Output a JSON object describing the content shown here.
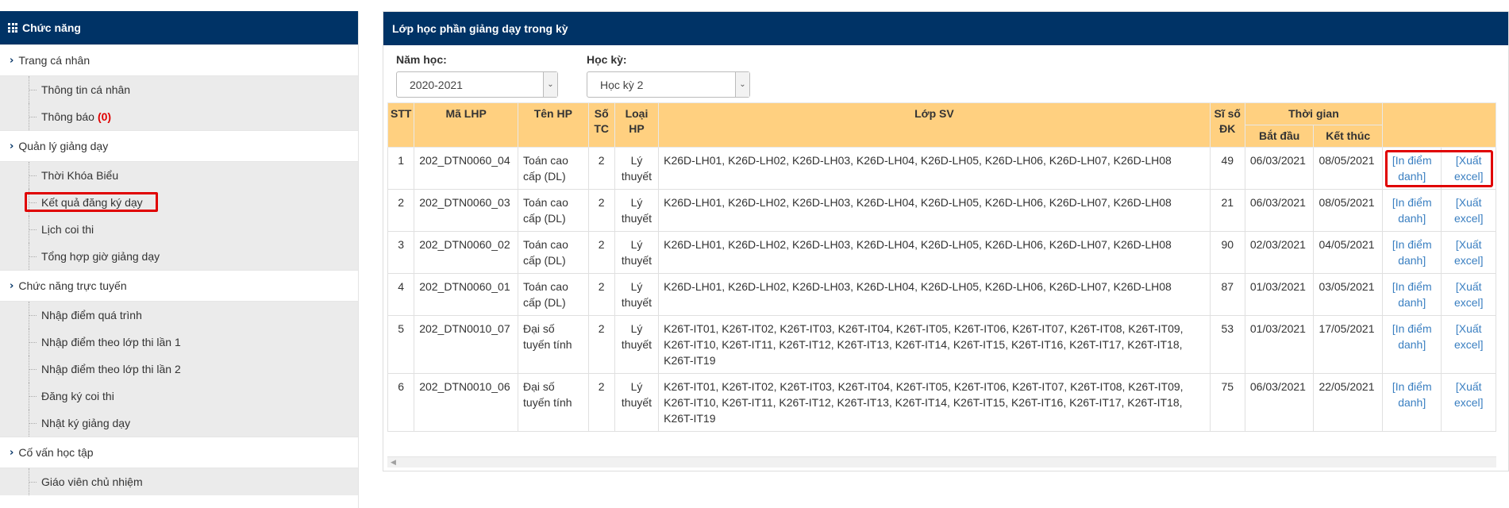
{
  "sidebar": {
    "title": "Chức năng",
    "groups": [
      {
        "label": "Trang cá nhân",
        "items": [
          {
            "label": "Thông tin cá nhân"
          },
          {
            "label": "Thông báo",
            "badge": "(0)"
          }
        ]
      },
      {
        "label": "Quản lý giảng dạy",
        "items": [
          {
            "label": "Thời Khóa Biểu"
          },
          {
            "label": "Kết quả đăng ký dạy"
          },
          {
            "label": "Lịch coi thi"
          },
          {
            "label": "Tổng hợp giờ giảng dạy"
          }
        ]
      },
      {
        "label": "Chức năng trực tuyến",
        "items": [
          {
            "label": "Nhập điểm quá trình"
          },
          {
            "label": "Nhập điểm theo lớp thi lần 1"
          },
          {
            "label": "Nhập điểm theo lớp thi lần 2"
          },
          {
            "label": "Đăng ký coi thi"
          },
          {
            "label": "Nhật ký giảng dạy"
          }
        ]
      },
      {
        "label": "Cố vấn học tập",
        "items": [
          {
            "label": "Giáo viên chủ nhiệm"
          }
        ]
      }
    ]
  },
  "main": {
    "title": "Lớp học phần giảng dạy trong kỳ",
    "filters": {
      "year_label": "Năm học:",
      "year_value": "2020-2021",
      "semester_label": "Học kỳ:",
      "semester_value": "Học kỳ 2"
    },
    "table": {
      "headers": {
        "stt": "STT",
        "ma_lhp": "Mã LHP",
        "ten_hp": "Tên HP",
        "so_tc": "Số TC",
        "loai_hp": "Loại HP",
        "lop_sv": "Lớp SV",
        "si_so": "Sĩ số ĐK",
        "thoi_gian": "Thời gian",
        "bat_dau": "Bắt đầu",
        "ket_thuc": "Kết thúc"
      },
      "action_print": "[In điểm danh]",
      "action_export": "[Xuất excel]",
      "rows": [
        {
          "stt": "1",
          "ma_lhp": "202_DTN0060_04",
          "ten_hp": "Toán cao cấp (DL)",
          "so_tc": "2",
          "loai_hp": "Lý thuyết",
          "lop_sv": "K26D-LH01, K26D-LH02, K26D-LH03, K26D-LH04, K26D-LH05, K26D-LH06, K26D-LH07, K26D-LH08",
          "si_so": "49",
          "bat_dau": "06/03/2021",
          "ket_thuc": "08/05/2021"
        },
        {
          "stt": "2",
          "ma_lhp": "202_DTN0060_03",
          "ten_hp": "Toán cao cấp (DL)",
          "so_tc": "2",
          "loai_hp": "Lý thuyết",
          "lop_sv": "K26D-LH01, K26D-LH02, K26D-LH03, K26D-LH04, K26D-LH05, K26D-LH06, K26D-LH07, K26D-LH08",
          "si_so": "21",
          "bat_dau": "06/03/2021",
          "ket_thuc": "08/05/2021"
        },
        {
          "stt": "3",
          "ma_lhp": "202_DTN0060_02",
          "ten_hp": "Toán cao cấp (DL)",
          "so_tc": "2",
          "loai_hp": "Lý thuyết",
          "lop_sv": "K26D-LH01, K26D-LH02, K26D-LH03, K26D-LH04, K26D-LH05, K26D-LH06, K26D-LH07, K26D-LH08",
          "si_so": "90",
          "bat_dau": "02/03/2021",
          "ket_thuc": "04/05/2021"
        },
        {
          "stt": "4",
          "ma_lhp": "202_DTN0060_01",
          "ten_hp": "Toán cao cấp (DL)",
          "so_tc": "2",
          "loai_hp": "Lý thuyết",
          "lop_sv": "K26D-LH01, K26D-LH02, K26D-LH03, K26D-LH04, K26D-LH05, K26D-LH06, K26D-LH07, K26D-LH08",
          "si_so": "87",
          "bat_dau": "01/03/2021",
          "ket_thuc": "03/05/2021"
        },
        {
          "stt": "5",
          "ma_lhp": "202_DTN0010_07",
          "ten_hp": "Đại số tuyến tính",
          "so_tc": "2",
          "loai_hp": "Lý thuyết",
          "lop_sv": "K26T-IT01, K26T-IT02, K26T-IT03, K26T-IT04, K26T-IT05, K26T-IT06, K26T-IT07, K26T-IT08, K26T-IT09, K26T-IT10, K26T-IT11, K26T-IT12, K26T-IT13, K26T-IT14, K26T-IT15, K26T-IT16, K26T-IT17, K26T-IT18, K26T-IT19",
          "si_so": "53",
          "bat_dau": "01/03/2021",
          "ket_thuc": "17/05/2021"
        },
        {
          "stt": "6",
          "ma_lhp": "202_DTN0010_06",
          "ten_hp": "Đại số tuyến tính",
          "so_tc": "2",
          "loai_hp": "Lý thuyết",
          "lop_sv": "K26T-IT01, K26T-IT02, K26T-IT03, K26T-IT04, K26T-IT05, K26T-IT06, K26T-IT07, K26T-IT08, K26T-IT09, K26T-IT10, K26T-IT11, K26T-IT12, K26T-IT13, K26T-IT14, K26T-IT15, K26T-IT16, K26T-IT17, K26T-IT18, K26T-IT19",
          "si_so": "75",
          "bat_dau": "06/03/2021",
          "ket_thuc": "22/05/2021"
        }
      ]
    }
  },
  "colors": {
    "header_bg": "#003366",
    "table_header_bg": "#ffd080",
    "highlight": "#e00000",
    "link": "#3a7fc1",
    "badge": "#e00000"
  }
}
